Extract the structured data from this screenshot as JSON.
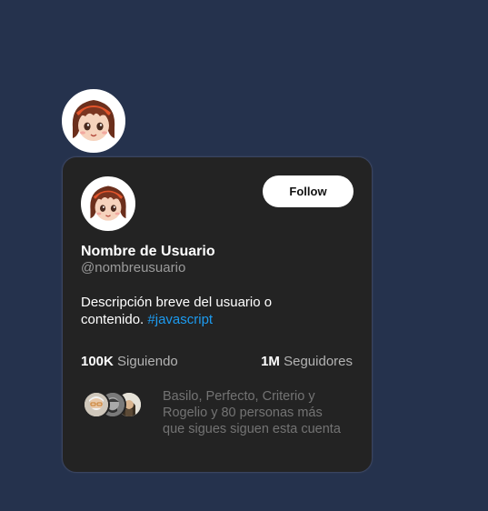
{
  "profile": {
    "display_name": "Nombre de Usuario",
    "handle": "@nombreusuario",
    "bio_text": "Descripción breve del usuario o contenido.",
    "hashtag": "#javascript",
    "following_count": "100K",
    "following_label": "Siguiendo",
    "followers_count": "1M",
    "followers_label": "Seguidores"
  },
  "follow_button": {
    "label": "Follow"
  },
  "mutuals": {
    "text": "Basilo, Perfecto, Criterio y Rogelio y 80 personas más que sigues siguen esta cuenta"
  },
  "colors": {
    "page_bg": "#25324d",
    "card_bg": "#232323",
    "hashtag": "#1d9bf0",
    "muted": "#737373"
  }
}
